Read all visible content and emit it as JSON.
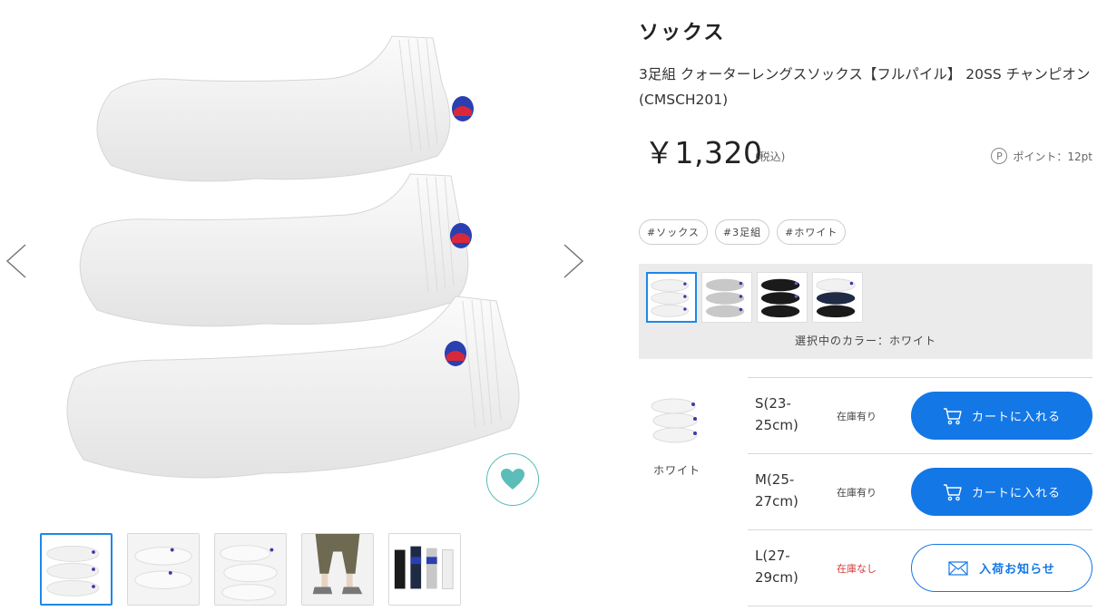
{
  "product": {
    "category": "ソックス",
    "title": "3足組 クォーターレングスソックス【フルパイル】 20SS チャンピオン(CMSCH201)",
    "price": "￥1,320",
    "tax_note": "(税込)",
    "points_icon_letter": "P",
    "points": "ポイント：12pt"
  },
  "tags": [
    "#ソックス",
    "#3足組",
    "#ホワイト"
  ],
  "colors": {
    "swatches": [
      {
        "name": "white",
        "fill": "#ffffff",
        "active": true
      },
      {
        "name": "gray",
        "fill": "#c8c8c8",
        "active": false
      },
      {
        "name": "black",
        "fill": "#1a1a1a",
        "active": false
      },
      {
        "name": "navy-mix",
        "fill": "#1f2a44",
        "active": false
      }
    ],
    "selected_label": "選択中のカラー：ホワイト"
  },
  "variant": {
    "color_label": "ホワイト",
    "sizes": [
      {
        "label": "S(23-25cm)",
        "stock": "在庫有り",
        "in_stock": true,
        "button": "カートに入れる"
      },
      {
        "label": "M(25-27cm)",
        "stock": "在庫有り",
        "in_stock": true,
        "button": "カートに入れる"
      },
      {
        "label": "L(27-29cm)",
        "stock": "在庫なし",
        "in_stock": false,
        "button": "入荷お知らせ"
      }
    ]
  },
  "gallery": {
    "thumbnail_count": 5,
    "active_index": 0
  },
  "theme": {
    "accent": "#1477e6",
    "favorite": "#5cbcb8",
    "out_of_stock": "#d23b3b",
    "logo_blue": "#2a3fb0",
    "logo_red": "#d8283a"
  }
}
